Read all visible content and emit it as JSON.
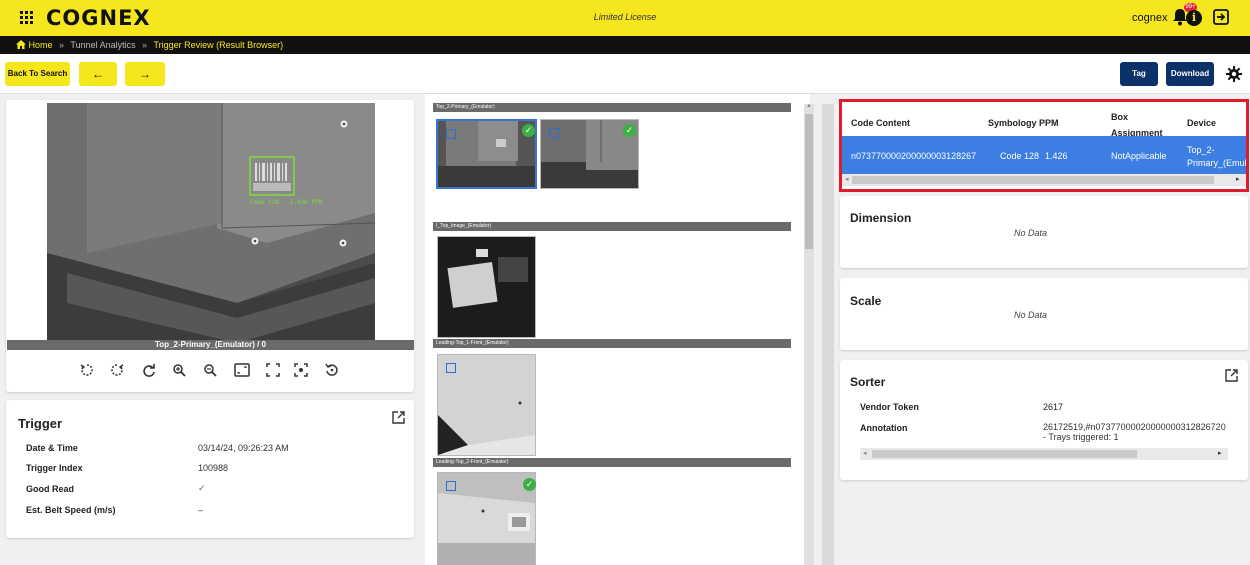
{
  "header": {
    "brand": "COGNEX",
    "license": "Limited License",
    "user": "cognex",
    "notifications_badge": "99+",
    "info_label": "i"
  },
  "breadcrumb": {
    "home": "Home",
    "separator": "»",
    "section": "Tunnel Analytics",
    "current": "Trigger Review (Result Browser)"
  },
  "toolbar": {
    "back_label": "Back To Search",
    "prev_label": "←",
    "next_label": "→",
    "tag_label": "Tag",
    "download_label": "Download"
  },
  "viewer": {
    "caption": "Top_2-Primary_(Emulator) / 0",
    "tools": [
      "rotate-ccw-icon",
      "rotate-cw-icon",
      "refresh-icon",
      "zoom-in-icon",
      "zoom-out-icon",
      "fit-screen-icon",
      "fullscreen-icon",
      "center-focus-icon",
      "reset-icon"
    ],
    "barcode_overlay": "Code 128 - 1.426 PPM"
  },
  "trigger": {
    "title": "Trigger",
    "fields": [
      {
        "label": "Date & Time",
        "value": "03/14/24, 09:26:23 AM"
      },
      {
        "label": "Trigger Index",
        "value": "100988"
      },
      {
        "label": "Good Read",
        "value": "✓"
      },
      {
        "label": "Est. Belt Speed (m/s)",
        "value": "–"
      }
    ]
  },
  "image_groups": [
    {
      "name": "Top_2-Primary_(Emulator)"
    },
    {
      "name": "I_Top_Image_(Emulator)"
    },
    {
      "name": "Leading-Top_1-Front_(Emulator)"
    },
    {
      "name": "Leading-Top_2-Front_(Emulator)"
    }
  ],
  "results_table": {
    "columns": [
      "Code Content",
      "Symbology",
      "PPM",
      "Box Assignment",
      "Device"
    ],
    "rows": [
      {
        "code": "n07377000020000000312826​7",
        "symbology": "Code 128",
        "ppm": "1.426",
        "box": "NotApplicable",
        "device": "Top_2-Primary_(Emul"
      }
    ]
  },
  "dimension": {
    "title": "Dimension",
    "value": "No Data"
  },
  "scale": {
    "title": "Scale",
    "value": "No Data"
  },
  "sorter": {
    "title": "Sorter",
    "vendor_label": "Vendor Token",
    "vendor_value": "2617",
    "annotation_label": "Annotation",
    "annotation_line1": "26172519,#n07377000020000000312826720",
    "annotation_line2": "- Trays triggered: 1"
  },
  "colors": {
    "brand_yellow": "#f5e61e",
    "navy": "#0b3268",
    "selection_blue": "#3c7ee2",
    "highlight_red": "#e21b2c",
    "ok_green": "#3cb043"
  }
}
